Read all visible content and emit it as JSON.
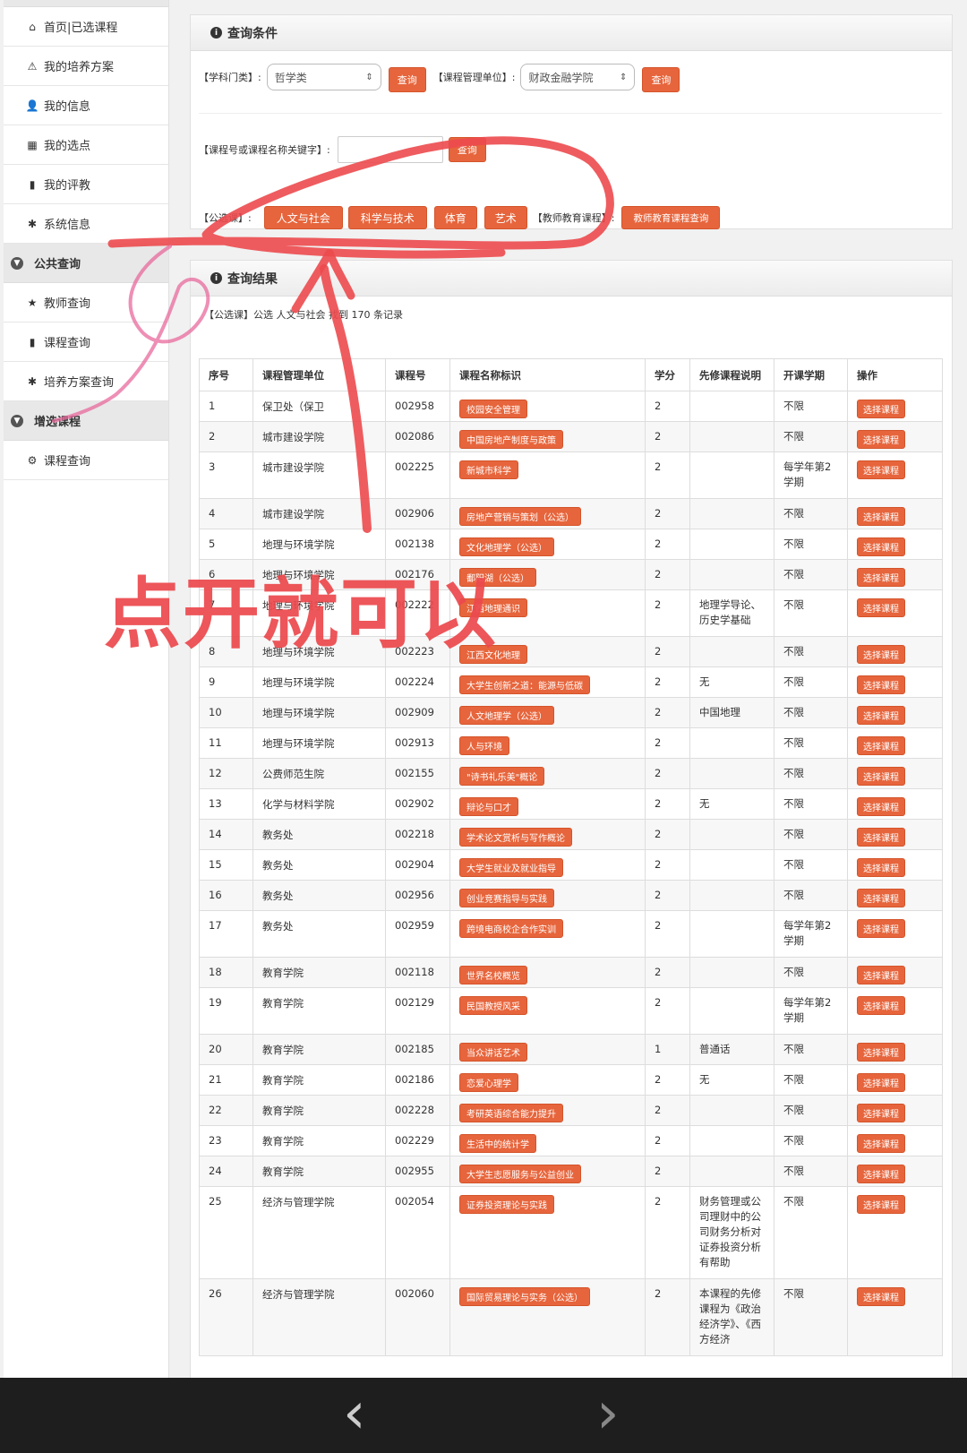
{
  "sidebar": {
    "items": [
      {
        "icon": "home-icon",
        "glyph": "⌂",
        "label": "首页|已选课程"
      },
      {
        "icon": "warning-icon",
        "glyph": "⚠",
        "label": "我的培养方案"
      },
      {
        "icon": "user-icon",
        "glyph": "👤",
        "label": "我的信息"
      },
      {
        "icon": "grid-icon",
        "glyph": "▦",
        "label": "我的选点"
      },
      {
        "icon": "bookmark-icon",
        "glyph": "▮",
        "label": "我的评教"
      },
      {
        "icon": "asterisk-icon",
        "glyph": "✱",
        "label": "系统信息"
      }
    ],
    "section1": "公共查询",
    "section1_items": [
      {
        "icon": "star-icon",
        "glyph": "★",
        "label": "教师查询"
      },
      {
        "icon": "book-icon",
        "glyph": "▮",
        "label": "课程查询"
      },
      {
        "icon": "asterisk-icon",
        "glyph": "✱",
        "label": "培养方案查询"
      }
    ],
    "section2": "增选课程",
    "section2_items": [
      {
        "icon": "gear-icon",
        "glyph": "⚙",
        "label": "课程查询"
      }
    ]
  },
  "query": {
    "title": "查询条件",
    "subject_label": "【学科门类】:",
    "subject_value": "哲学类",
    "query_btn": "查询",
    "unit_label": "【课程管理单位】:",
    "unit_value": "财政金融学院",
    "keyword_label": "【课程号或课程名称关键字】:",
    "public_label": "【公选课】:",
    "public_tags": [
      "人文与社会",
      "科学与技术",
      "体育",
      "艺术"
    ],
    "teacher_label": "【教师教育课程】:",
    "teacher_btn": "教师教育课程查询"
  },
  "result": {
    "title": "查询结果",
    "summary": "【公选课】公选 人文与社会 找到 170 条记录",
    "headers": [
      "序号",
      "课程管理单位",
      "课程号",
      "课程名称标识",
      "学分",
      "先修课程说明",
      "开课学期",
      "操作"
    ],
    "select_label": "选择课程",
    "rows": [
      {
        "no": "1",
        "unit": "保卫处（保卫",
        "code": "002958",
        "name": "校园安全管理",
        "credit": "2",
        "pre": "",
        "term": "不限"
      },
      {
        "no": "2",
        "unit": "城市建设学院",
        "code": "002086",
        "name": "中国房地产制度与政策",
        "credit": "2",
        "pre": "",
        "term": "不限"
      },
      {
        "no": "3",
        "unit": "城市建设学院",
        "code": "002225",
        "name": "新城市科学",
        "credit": "2",
        "pre": "",
        "term": "每学年第2学期"
      },
      {
        "no": "4",
        "unit": "城市建设学院",
        "code": "002906",
        "name": "房地产营销与策划（公选）",
        "credit": "2",
        "pre": "",
        "term": "不限"
      },
      {
        "no": "5",
        "unit": "地理与环境学院",
        "code": "002138",
        "name": "文化地理学（公选）",
        "credit": "2",
        "pre": "",
        "term": "不限"
      },
      {
        "no": "6",
        "unit": "地理与环境学院",
        "code": "002176",
        "name": "鄱阳湖（公选）",
        "credit": "2",
        "pre": "",
        "term": "不限"
      },
      {
        "no": "7",
        "unit": "地理与环境学院",
        "code": "002222",
        "name": "江西地理通识",
        "credit": "2",
        "pre": "地理学导论、历史学基础",
        "term": "不限"
      },
      {
        "no": "8",
        "unit": "地理与环境学院",
        "code": "002223",
        "name": "江西文化地理",
        "credit": "2",
        "pre": "",
        "term": "不限"
      },
      {
        "no": "9",
        "unit": "地理与环境学院",
        "code": "002224",
        "name": "大学生创新之道：能源与低碳",
        "credit": "2",
        "pre": "无",
        "term": "不限"
      },
      {
        "no": "10",
        "unit": "地理与环境学院",
        "code": "002909",
        "name": "人文地理学（公选）",
        "credit": "2",
        "pre": "中国地理",
        "term": "不限"
      },
      {
        "no": "11",
        "unit": "地理与环境学院",
        "code": "002913",
        "name": "人与环境",
        "credit": "2",
        "pre": "",
        "term": "不限"
      },
      {
        "no": "12",
        "unit": "公费师范生院",
        "code": "002155",
        "name": "\"诗书礼乐美\"概论",
        "credit": "2",
        "pre": "",
        "term": "不限"
      },
      {
        "no": "13",
        "unit": "化学与材料学院",
        "code": "002902",
        "name": "辩论与口才",
        "credit": "2",
        "pre": "无",
        "term": "不限"
      },
      {
        "no": "14",
        "unit": "教务处",
        "code": "002218",
        "name": "学术论文赏析与写作概论",
        "credit": "2",
        "pre": "",
        "term": "不限"
      },
      {
        "no": "15",
        "unit": "教务处",
        "code": "002904",
        "name": "大学生就业及就业指导",
        "credit": "2",
        "pre": "",
        "term": "不限"
      },
      {
        "no": "16",
        "unit": "教务处",
        "code": "002956",
        "name": "创业竞赛指导与实践",
        "credit": "2",
        "pre": "",
        "term": "不限"
      },
      {
        "no": "17",
        "unit": "教务处",
        "code": "002959",
        "name": "跨境电商校企合作实训",
        "credit": "2",
        "pre": "",
        "term": "每学年第2学期"
      },
      {
        "no": "18",
        "unit": "教育学院",
        "code": "002118",
        "name": "世界名校概览",
        "credit": "2",
        "pre": "",
        "term": "不限"
      },
      {
        "no": "19",
        "unit": "教育学院",
        "code": "002129",
        "name": "民国教授风采",
        "credit": "2",
        "pre": "",
        "term": "每学年第2学期"
      },
      {
        "no": "20",
        "unit": "教育学院",
        "code": "002185",
        "name": "当众讲话艺术",
        "credit": "1",
        "pre": "普通话",
        "term": "不限"
      },
      {
        "no": "21",
        "unit": "教育学院",
        "code": "002186",
        "name": "恋爱心理学",
        "credit": "2",
        "pre": "无",
        "term": "不限"
      },
      {
        "no": "22",
        "unit": "教育学院",
        "code": "002228",
        "name": "考研英语综合能力提升",
        "credit": "2",
        "pre": "",
        "term": "不限"
      },
      {
        "no": "23",
        "unit": "教育学院",
        "code": "002229",
        "name": "生活中的统计学",
        "credit": "2",
        "pre": "",
        "term": "不限"
      },
      {
        "no": "24",
        "unit": "教育学院",
        "code": "002955",
        "name": "大学生志愿服务与公益创业",
        "credit": "2",
        "pre": "",
        "term": "不限"
      },
      {
        "no": "25",
        "unit": "经济与管理学院",
        "code": "002054",
        "name": "证券投资理论与实践",
        "credit": "2",
        "pre": "财务管理或公司理财中的公司财务分析对证券投资分析有帮助",
        "term": "不限"
      },
      {
        "no": "26",
        "unit": "经济与管理学院",
        "code": "002060",
        "name": "国际贸易理论与实务（公选）",
        "credit": "2",
        "pre": "本课程的先修课程为《政治经济学》、《西方经济",
        "term": "不限"
      }
    ]
  },
  "annotation": {
    "caption": "点开就可以"
  },
  "nav": {
    "back_glyph": "‹",
    "forward_glyph": "›"
  }
}
